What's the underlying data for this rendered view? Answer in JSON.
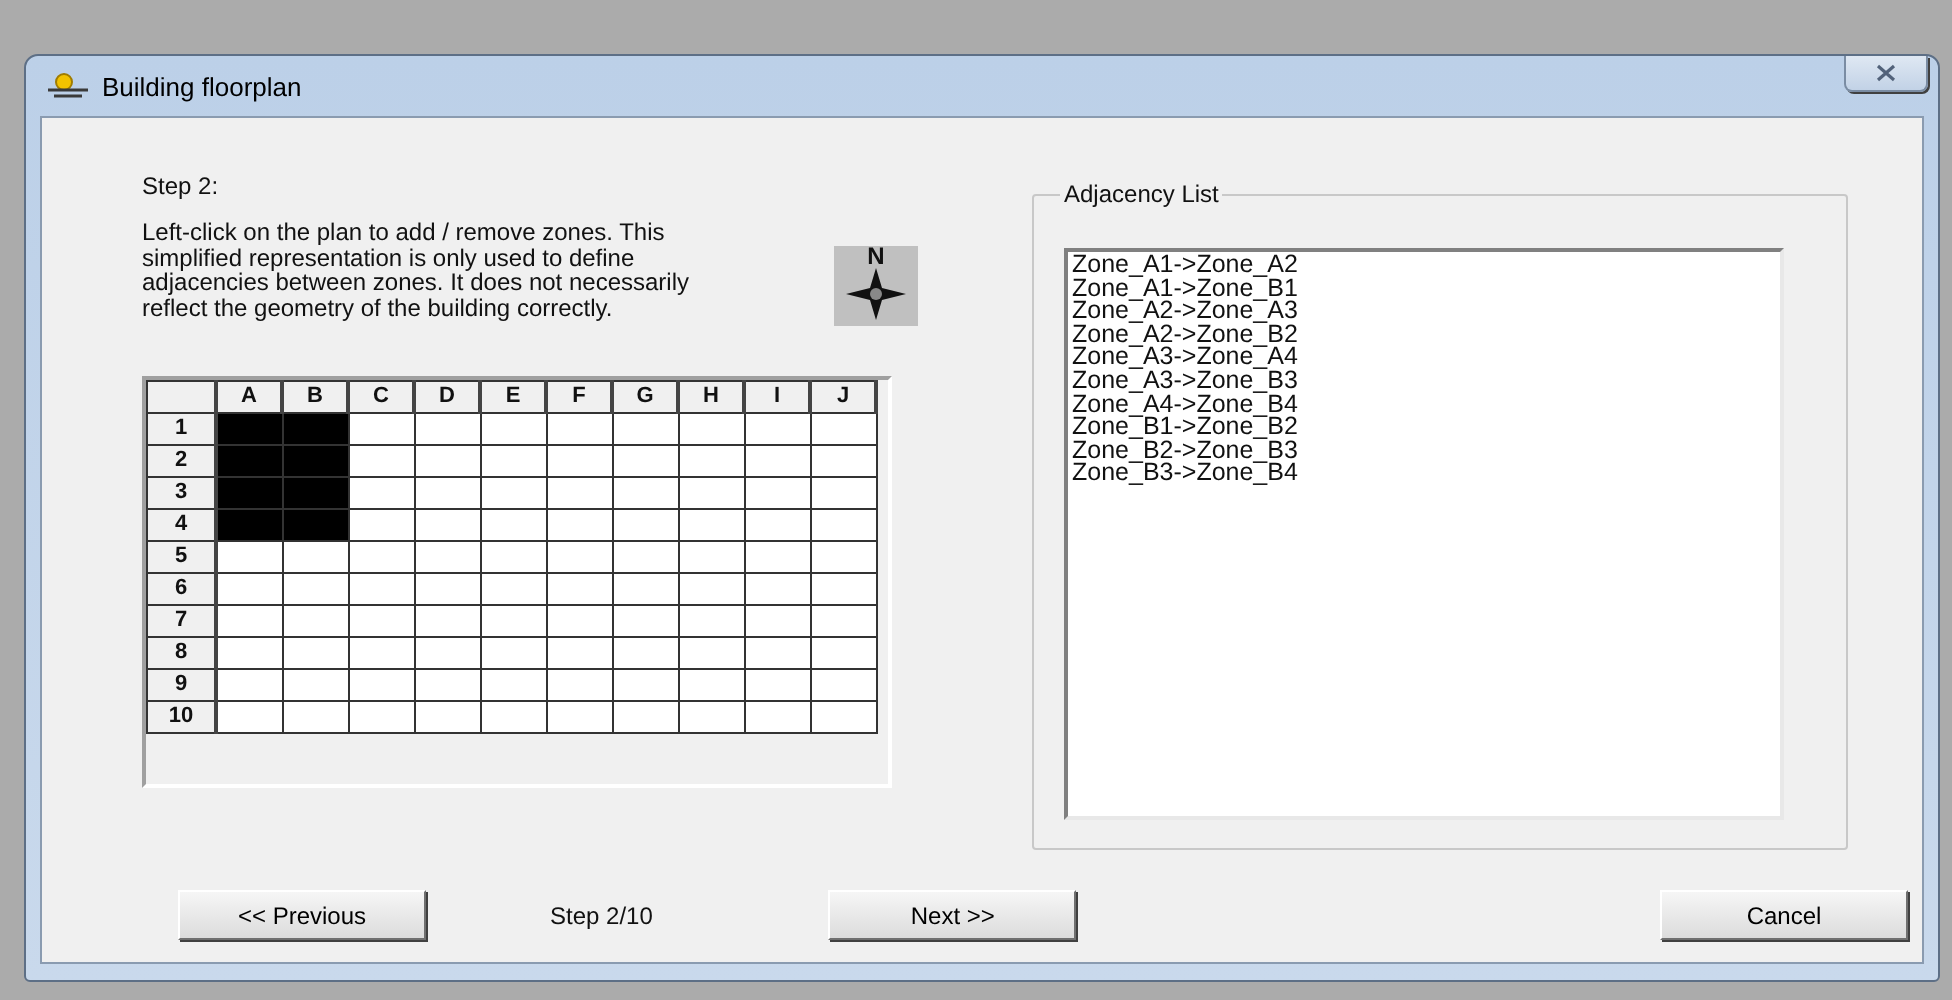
{
  "window": {
    "title": "Building floorplan"
  },
  "step_title": "Step 2:",
  "instructions": "Left-click on the plan to add / remove zones. This simplified representation is only used to define adjacencies between zones. It does not necessarily reflect the geometry of the building correctly.",
  "compass": {
    "label": "N"
  },
  "grid": {
    "columns": [
      "A",
      "B",
      "C",
      "D",
      "E",
      "F",
      "G",
      "H",
      "I",
      "J"
    ],
    "rows": [
      {
        "label": "1",
        "cells": [
          {
            "filled": true
          },
          {
            "filled": true
          },
          {
            "filled": false
          },
          {
            "filled": false
          },
          {
            "filled": false
          },
          {
            "filled": false
          },
          {
            "filled": false
          },
          {
            "filled": false
          },
          {
            "filled": false
          },
          {
            "filled": false
          }
        ]
      },
      {
        "label": "2",
        "cells": [
          {
            "filled": true
          },
          {
            "filled": true
          },
          {
            "filled": false
          },
          {
            "filled": false
          },
          {
            "filled": false
          },
          {
            "filled": false
          },
          {
            "filled": false
          },
          {
            "filled": false
          },
          {
            "filled": false
          },
          {
            "filled": false
          }
        ]
      },
      {
        "label": "3",
        "cells": [
          {
            "filled": true
          },
          {
            "filled": true
          },
          {
            "filled": false
          },
          {
            "filled": false
          },
          {
            "filled": false
          },
          {
            "filled": false
          },
          {
            "filled": false
          },
          {
            "filled": false
          },
          {
            "filled": false
          },
          {
            "filled": false
          }
        ]
      },
      {
        "label": "4",
        "cells": [
          {
            "filled": true
          },
          {
            "filled": true
          },
          {
            "filled": false
          },
          {
            "filled": false
          },
          {
            "filled": false
          },
          {
            "filled": false
          },
          {
            "filled": false
          },
          {
            "filled": false
          },
          {
            "filled": false
          },
          {
            "filled": false
          }
        ]
      },
      {
        "label": "5",
        "cells": [
          {
            "filled": false
          },
          {
            "filled": false
          },
          {
            "filled": false
          },
          {
            "filled": false
          },
          {
            "filled": false
          },
          {
            "filled": false
          },
          {
            "filled": false
          },
          {
            "filled": false
          },
          {
            "filled": false
          },
          {
            "filled": false
          }
        ]
      },
      {
        "label": "6",
        "cells": [
          {
            "filled": false
          },
          {
            "filled": false
          },
          {
            "filled": false
          },
          {
            "filled": false
          },
          {
            "filled": false
          },
          {
            "filled": false
          },
          {
            "filled": false
          },
          {
            "filled": false
          },
          {
            "filled": false
          },
          {
            "filled": false
          }
        ]
      },
      {
        "label": "7",
        "cells": [
          {
            "filled": false
          },
          {
            "filled": false
          },
          {
            "filled": false
          },
          {
            "filled": false
          },
          {
            "filled": false
          },
          {
            "filled": false
          },
          {
            "filled": false
          },
          {
            "filled": false
          },
          {
            "filled": false
          },
          {
            "filled": false
          }
        ]
      },
      {
        "label": "8",
        "cells": [
          {
            "filled": false
          },
          {
            "filled": false
          },
          {
            "filled": false
          },
          {
            "filled": false
          },
          {
            "filled": false
          },
          {
            "filled": false
          },
          {
            "filled": false
          },
          {
            "filled": false
          },
          {
            "filled": false
          },
          {
            "filled": false
          }
        ]
      },
      {
        "label": "9",
        "cells": [
          {
            "filled": false
          },
          {
            "filled": false
          },
          {
            "filled": false
          },
          {
            "filled": false
          },
          {
            "filled": false
          },
          {
            "filled": false
          },
          {
            "filled": false
          },
          {
            "filled": false
          },
          {
            "filled": false
          },
          {
            "filled": false
          }
        ]
      },
      {
        "label": "10",
        "cells": [
          {
            "filled": false
          },
          {
            "filled": false
          },
          {
            "filled": false
          },
          {
            "filled": false
          },
          {
            "filled": false
          },
          {
            "filled": false
          },
          {
            "filled": false
          },
          {
            "filled": false
          },
          {
            "filled": false
          },
          {
            "filled": false
          }
        ]
      }
    ]
  },
  "adjacency": {
    "title": "Adjacency List",
    "items": [
      "Zone_A1->Zone_A2",
      "Zone_A1->Zone_B1",
      "Zone_A2->Zone_A3",
      "Zone_A2->Zone_B2",
      "Zone_A3->Zone_A4",
      "Zone_A3->Zone_B3",
      "Zone_A4->Zone_B4",
      "Zone_B1->Zone_B2",
      "Zone_B2->Zone_B3",
      "Zone_B3->Zone_B4"
    ]
  },
  "footer": {
    "previous": "<< Previous",
    "step_indicator": "Step 2/10",
    "next": "Next >>",
    "cancel": "Cancel"
  }
}
